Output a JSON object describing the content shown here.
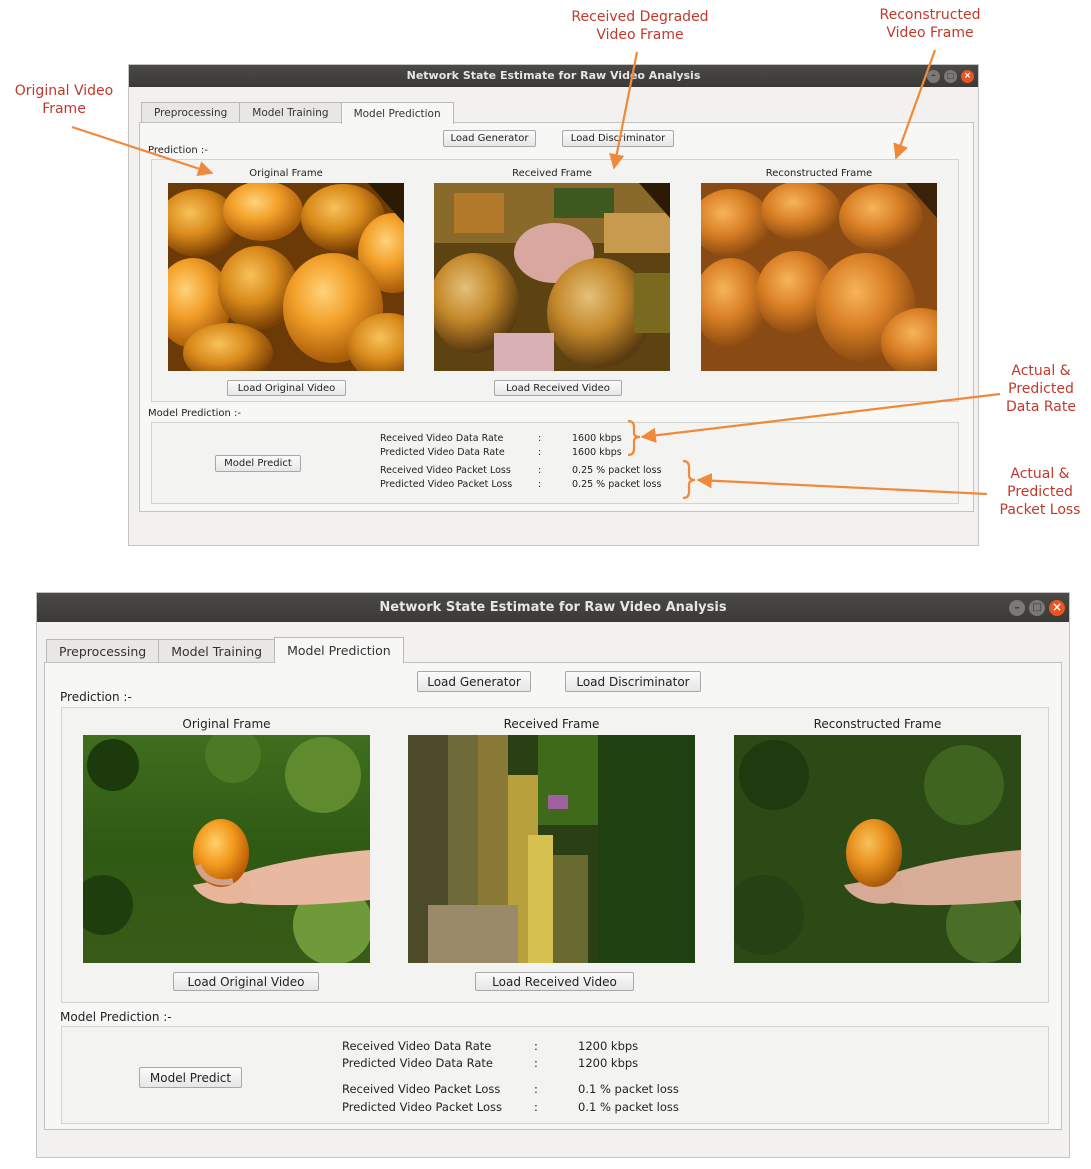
{
  "annotations": {
    "original": [
      "Original Video",
      "Frame"
    ],
    "received": [
      "Received Degraded",
      "Video Frame"
    ],
    "reconstructed": [
      "Reconstructed",
      "Video Frame"
    ],
    "data_rate": [
      "Actual &",
      "Predicted",
      "Data Rate"
    ],
    "packet_loss": [
      "Actual &",
      "Predicted",
      "Packet Loss"
    ]
  },
  "window_top": {
    "title": "Network State Estimate for Raw Video Analysis",
    "tabs": [
      "Preprocessing",
      "Model Training",
      "Model Prediction"
    ],
    "active_tab": "Model Prediction",
    "load_generator": "Load Generator",
    "load_discriminator": "Load Discriminator",
    "prediction_label": "Prediction :-",
    "frames": {
      "original": "Original Frame",
      "received": "Received Frame",
      "reconstructed": "Reconstructed Frame"
    },
    "load_original": "Load Original Video",
    "load_received": "Load Received Video",
    "model_prediction_label": "Model Prediction :-",
    "model_predict": "Model Predict",
    "metrics": [
      {
        "label": "Received Video Data Rate",
        "sep": ":",
        "value": "1600 kbps"
      },
      {
        "label": "Predicted Video Data Rate",
        "sep": ":",
        "value": "1600 kbps"
      },
      {
        "label": "Received Video Packet Loss",
        "sep": ":",
        "value": "0.25 % packet loss"
      },
      {
        "label": "Predicted Video Packet Loss",
        "sep": ":",
        "value": "0.25 % packet loss"
      }
    ]
  },
  "window_bottom": {
    "title": "Network State Estimate for Raw Video Analysis",
    "tabs": [
      "Preprocessing",
      "Model Training",
      "Model Prediction"
    ],
    "active_tab": "Model Prediction",
    "load_generator": "Load Generator",
    "load_discriminator": "Load Discriminator",
    "prediction_label": "Prediction :-",
    "frames": {
      "original": "Original Frame",
      "received": "Received Frame",
      "reconstructed": "Reconstructed Frame"
    },
    "load_original": "Load Original Video",
    "load_received": "Load Received Video",
    "model_prediction_label": "Model Prediction :-",
    "model_predict": "Model Predict",
    "metrics": [
      {
        "label": "Received Video Data Rate",
        "sep": ":",
        "value": "1200 kbps"
      },
      {
        "label": "Predicted Video Data Rate",
        "sep": ":",
        "value": "1200 kbps"
      },
      {
        "label": "Received Video Packet Loss",
        "sep": ":",
        "value": "0.1 % packet loss"
      },
      {
        "label": "Predicted Video Packet Loss",
        "sep": ":",
        "value": "0.1 % packet loss"
      }
    ]
  },
  "colors": {
    "annotation": "#c0392b",
    "close_button": "#e95420",
    "titlebar": "#3c3b37"
  },
  "icons": {
    "minimize": "minimize-icon",
    "maximize": "maximize-icon",
    "close": "close-icon"
  }
}
